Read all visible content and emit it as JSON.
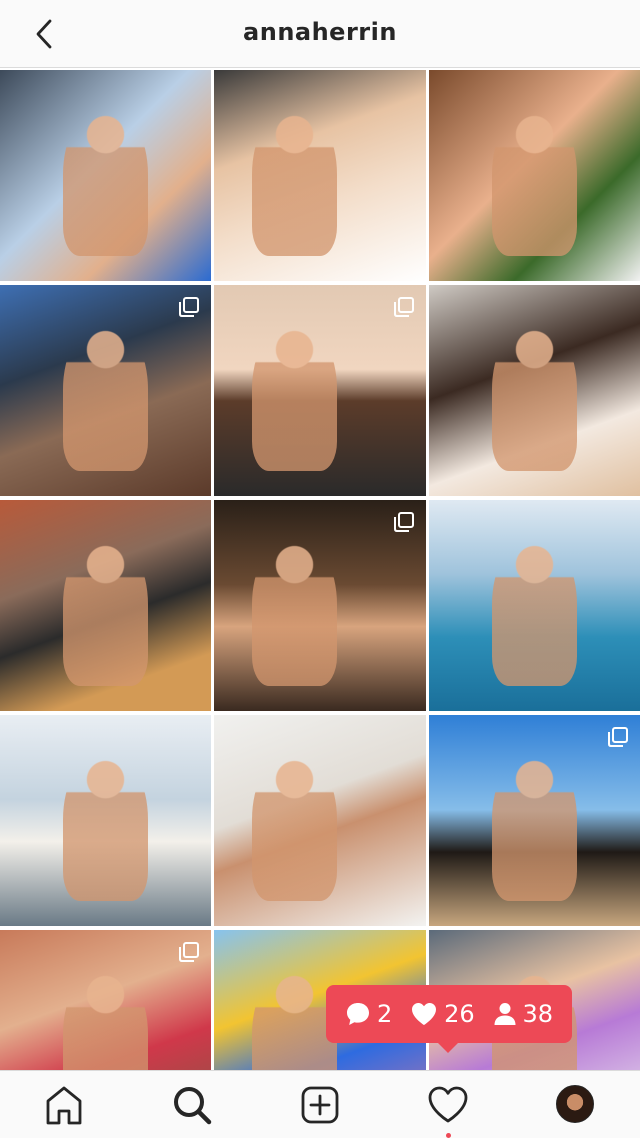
{
  "header": {
    "title": "annaherrin",
    "back_icon": "chevron-left-icon"
  },
  "grid": {
    "tiles": [
      {
        "bg": "linear-gradient(135deg,#3d4a5a,#b9cfe6 45%,#e2b08c 70%,#2b6bd1)",
        "multi": false
      },
      {
        "bg": "linear-gradient(160deg,#3a3a3a,#e7c3a3 35%,#f3ddc9 60%,#ffffff)",
        "multi": false
      },
      {
        "bg": "linear-gradient(135deg,#7a4a2c,#e9b08c 45%,#3b6a2a 70%,#f2f2f2)",
        "multi": false
      },
      {
        "bg": "linear-gradient(160deg,#3e6fb3,#2b3a4d 35%,#8a6a55 60%,#5b3a2a)",
        "multi": true
      },
      {
        "bg": "linear-gradient(180deg,#e2c9b3,#f1d6c0 40%,#5c3c2a 55%,#2a2a2a)",
        "multi": true
      },
      {
        "bg": "linear-gradient(160deg,#cfcac4,#3b2a22 40%,#f3e9e0 70%,#e0c0a0)",
        "multi": false
      },
      {
        "bg": "linear-gradient(160deg,#b85a3a,#8a6b5a 35%,#2b2b2b 55%,#d39a55 80%)",
        "multi": false
      },
      {
        "bg": "linear-gradient(180deg,#2a2018,#6a4a32 40%,#d8a47e 60%,#3a2a20)",
        "multi": true
      },
      {
        "bg": "linear-gradient(180deg,#dfe9f2,#9fc3dc 35%,#2d8fb8 65%,#1a6f9a)",
        "multi": false
      },
      {
        "bg": "linear-gradient(180deg,#e9eef3,#c4d3df 40%,#f3f0ea 60%,#6a7a86)",
        "multi": false
      },
      {
        "bg": "linear-gradient(160deg,#f1f1ef,#e2ddd6 40%,#c9906e 55%,#f3f3f1)",
        "multi": false
      },
      {
        "bg": "linear-gradient(180deg,#2f7fd6,#86bde9 45%,#1f1a16 65%,#c7a67e)",
        "multi": true
      },
      {
        "bg": "linear-gradient(160deg,#c87a5a,#e3b08e 35%,#d0384a 60%,#7a5a44)",
        "multi": true
      },
      {
        "bg": "linear-gradient(160deg,#87c3ee,#f2c431 35%,#2e6be0 60%,#d87aa0)",
        "multi": false
      },
      {
        "bg": "linear-gradient(160deg,#5b6a7a,#e8c2a2 35%,#b77ad6 55%,#f2f2f2)",
        "multi": false
      }
    ]
  },
  "notification": {
    "comment_icon": "comment-bubble-icon",
    "comments": "2",
    "like_icon": "heart-icon",
    "likes": "26",
    "follow_icon": "person-icon",
    "follows": "38",
    "color": "#ed4956"
  },
  "navbar": {
    "items": [
      "home-icon",
      "search-icon",
      "new-post-icon",
      "activity-heart-icon",
      "profile-avatar"
    ]
  }
}
